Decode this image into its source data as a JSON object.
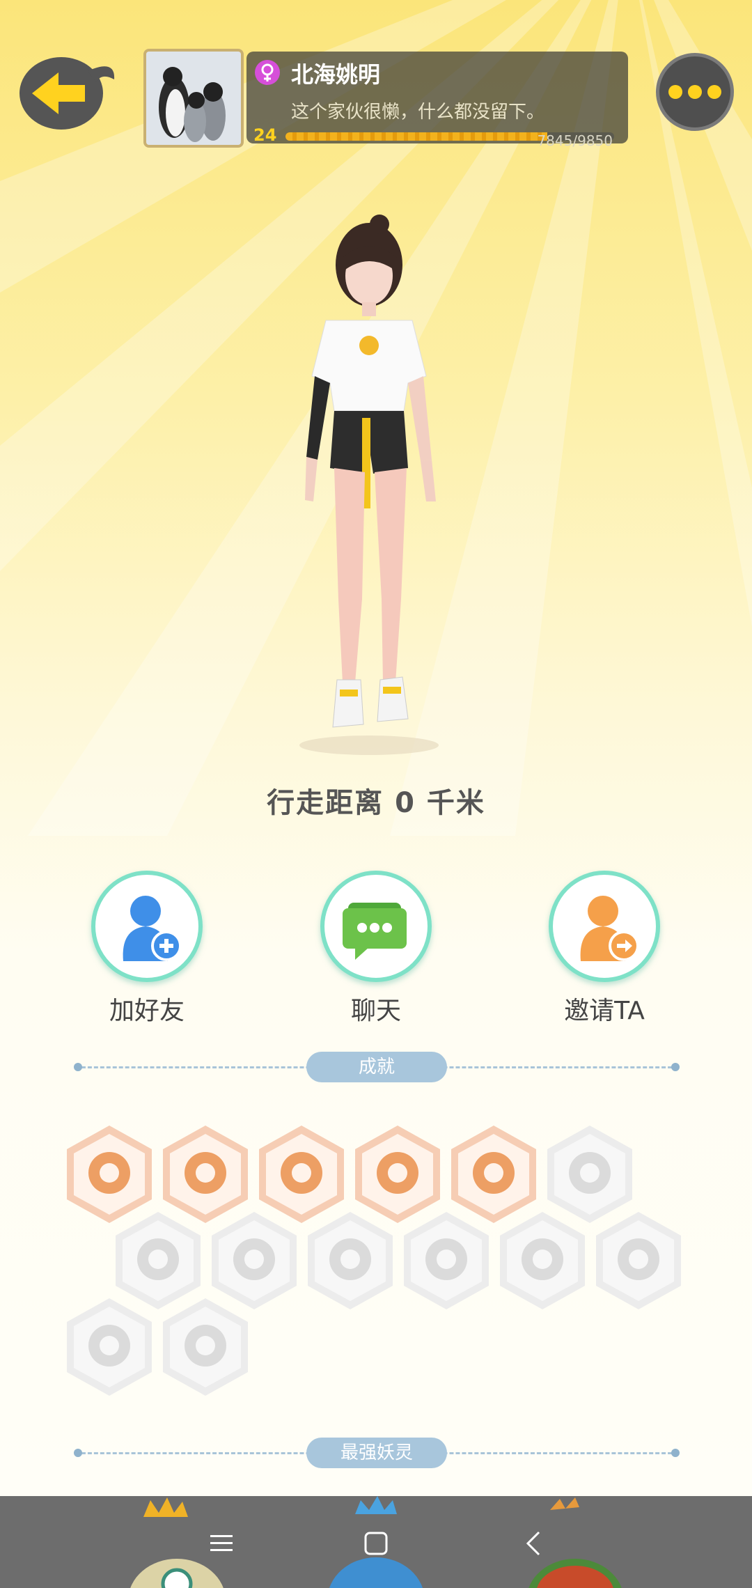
{
  "header": {
    "nickname": "北海姚明",
    "signature": "这个家伙很懒，什么都没留下。",
    "level": "24",
    "exp_text": "7845/9850",
    "exp_progress": 0.796
  },
  "walk_distance": "行走距离 0 千米",
  "actions": [
    {
      "label": "加好友",
      "icon": "add-friend-icon"
    },
    {
      "label": "聊天",
      "icon": "chat-icon"
    },
    {
      "label": "邀请TA",
      "icon": "invite-icon"
    }
  ],
  "sections": {
    "achievements_title": "成就",
    "strongest_title": "最强妖灵"
  },
  "achievements": [
    {
      "icon": "target-badge-icon",
      "unlocked": true
    },
    {
      "icon": "fox-badge-icon",
      "unlocked": true
    },
    {
      "icon": "moon-badge-icon",
      "unlocked": true
    },
    {
      "icon": "yinyang-swirl-badge-icon",
      "unlocked": true
    },
    {
      "icon": "yinyang-book-badge-icon",
      "unlocked": true
    },
    {
      "icon": "sneaker-badge-icon",
      "unlocked": false
    },
    {
      "icon": "ball-badge-icon",
      "unlocked": false
    },
    {
      "icon": "bird-badge-icon",
      "unlocked": false
    },
    {
      "icon": "monster-badge-icon",
      "unlocked": false
    },
    {
      "icon": "cart-badge-icon",
      "unlocked": false
    },
    {
      "icon": "cat-badge-icon",
      "unlocked": false
    },
    {
      "icon": "dragon-badge-icon",
      "unlocked": false
    },
    {
      "icon": "shield-badge-icon",
      "unlocked": false
    },
    {
      "icon": "book-fox-badge-icon",
      "unlocked": false
    }
  ],
  "colors": {
    "accent_yellow": "#ffd21f",
    "teal_ring": "#7ee1c7",
    "blue_icon": "#3f8fe8",
    "orange_icon": "#f5a04a",
    "green_chat": "#6cc24a"
  }
}
